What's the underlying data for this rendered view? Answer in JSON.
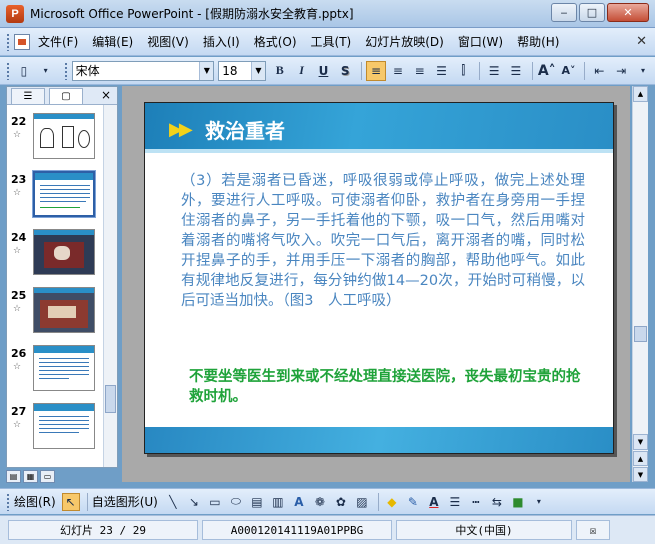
{
  "window": {
    "app_icon": "powerpoint-icon",
    "title": "Microsoft Office PowerPoint - [假期防溺水安全教育.pptx]",
    "buttons": [
      "minimize-icon",
      "maximize-icon",
      "close-icon"
    ]
  },
  "menubar": {
    "items": [
      "文件(F)",
      "编辑(E)",
      "视图(V)",
      "插入(I)",
      "格式(O)",
      "工具(T)",
      "幻灯片放映(D)",
      "窗口(W)",
      "帮助(H)"
    ]
  },
  "toolbar": {
    "font_name": "宋体",
    "font_size": "18",
    "bold": "B",
    "italic": "I",
    "underline": "U",
    "shadow": "S"
  },
  "outline_pane": {
    "tabs": [
      "outline-tab",
      "slides-tab"
    ],
    "close": "×",
    "thumbnails": [
      {
        "num": "22",
        "type": "image-bw"
      },
      {
        "num": "23",
        "type": "text",
        "selected": true
      },
      {
        "num": "24",
        "type": "photo"
      },
      {
        "num": "25",
        "type": "photo"
      },
      {
        "num": "26",
        "type": "text"
      },
      {
        "num": "27",
        "type": "text"
      }
    ]
  },
  "slide": {
    "title": "救治重者",
    "body": "（3）若是溺者已昏迷，呼吸很弱或停止呼吸，做完上述处理外，要进行人工呼吸。可使溺者仰卧，救护者在身旁用一手捏住溺者的鼻子，另一手托着他的下颚，吸一口气，然后用嘴对着溺者的嘴将气吹入。吹完一口气后，离开溺者的嘴，同时松开捏鼻子的手，并用手压一下溺者的胸部，帮助他呼气。如此有规律地反复进行，每分钟约做14—20次，开始时可稍慢，以后可适当加快。（图3　人工呼吸）",
    "emphasis": "不要坐等医生到来或不经处理直接送医院，丧失最初宝贵的抢救时机。",
    "colors": {
      "header": "#2a8ec6",
      "body_text": "#4a86c0",
      "emphasis_text": "#1fa33a",
      "arrows": "#f3d21a"
    }
  },
  "drawbar": {
    "draw_label": "绘图(R)",
    "autoshapes_label": "自选图形(U)"
  },
  "statusbar": {
    "slide_pos": "幻灯片 23 / 29",
    "template": "A000120141119A01PPBG",
    "language": "中文(中国)"
  }
}
